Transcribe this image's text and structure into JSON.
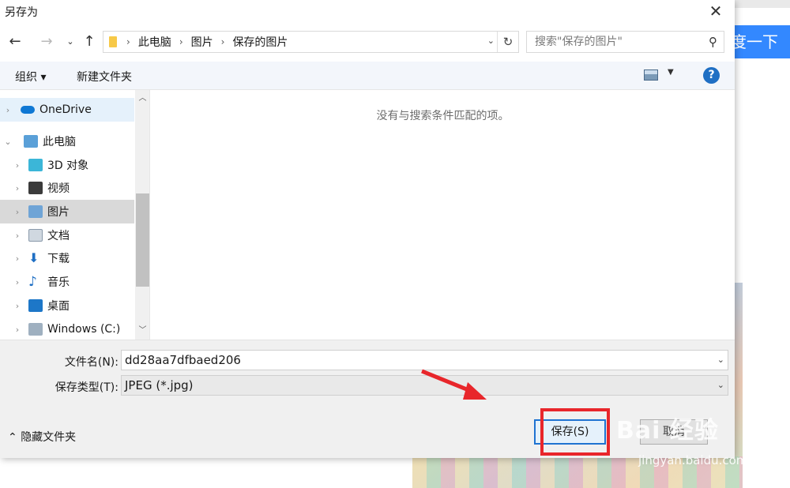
{
  "background": {
    "search_button_label": "度一下",
    "watermark_brand": "Bai 经验",
    "watermark_url": "jingyan.baidu.com"
  },
  "dialog": {
    "title": "另存为",
    "close_icon": "close-icon",
    "address": {
      "crumbs": [
        "此电脑",
        "图片",
        "保存的图片"
      ]
    },
    "search_placeholder": "搜索\"保存的图片\"",
    "toolbar": {
      "organize_label": "组织 ▾",
      "new_folder_label": "新建文件夹",
      "help_label": "?"
    },
    "nav": {
      "items": [
        {
          "label": "OneDrive",
          "icon": "cloud-icon"
        },
        {
          "label": "此电脑",
          "icon": "computer-icon"
        },
        {
          "label": "3D 对象",
          "icon": "cube-icon"
        },
        {
          "label": "视频",
          "icon": "video-icon"
        },
        {
          "label": "图片",
          "icon": "picture-icon"
        },
        {
          "label": "文档",
          "icon": "document-icon"
        },
        {
          "label": "下载",
          "icon": "download-icon"
        },
        {
          "label": "音乐",
          "icon": "music-icon"
        },
        {
          "label": "桌面",
          "icon": "desktop-icon"
        },
        {
          "label": "Windows (C:)",
          "icon": "drive-icon"
        }
      ]
    },
    "empty_message": "没有与搜索条件匹配的项。",
    "filename_label": "文件名(N):",
    "filename_value": "dd28aa7dfbaed206",
    "filetype_label": "保存类型(T):",
    "filetype_value": "JPEG (*.jpg)",
    "hide_folders_label": "隐藏文件夹",
    "save_label": "保存(S)",
    "cancel_label": "取消"
  },
  "colors": {
    "accent": "#1f73d1",
    "annotation_red": "#e8262b",
    "baidu_blue": "#3388ff"
  }
}
